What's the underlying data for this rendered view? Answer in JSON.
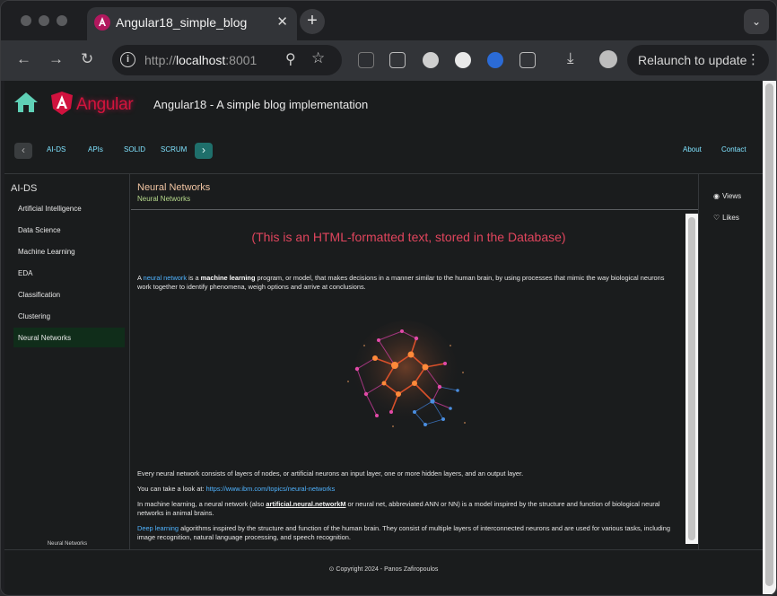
{
  "browser": {
    "tab_title": "Angular18_simple_blog",
    "tab_close": "✕",
    "new_tab": "+",
    "tab_menu": "⌄",
    "url_scheme": "http://",
    "url_host": "localhost",
    "url_port": ":8001",
    "relaunch_label": "Relaunch to update",
    "relaunch_menu": "⋮"
  },
  "header": {
    "brand": "Angular",
    "title": "Angular18 - A simple blog implementation"
  },
  "subnav": {
    "left_arrow": "‹",
    "right_arrow": "›",
    "items": [
      "AI-DS",
      "APIs",
      "SOLID",
      "SCRUM"
    ],
    "right_items": [
      "About",
      "Contact"
    ]
  },
  "sidebar": {
    "heading": "AI-DS",
    "items": [
      "Artificial Intelligence",
      "Data Science",
      "Machine Learning",
      "EDA",
      "Classification",
      "Clustering",
      "Neural Networks"
    ],
    "active_index": 6,
    "footer": "Neural Networks"
  },
  "post": {
    "title": "Neural Networks",
    "subtitle": "Neural Networks",
    "html_note": "(This is an HTML-formatted text, stored in the Database)",
    "p1_pre": "A ",
    "p1_link": "neural network",
    "p1_mid1": " is a ",
    "p1_bold": "machine learning",
    "p1_rest": " program, or model, that makes decisions in a manner similar to the human brain, by using processes that mimic the way biological neurons work together to identify phenomena, weigh options and arrive at conclusions.",
    "p2": "Every neural network consists of layers of nodes, or artificial neurons an input layer, one or more hidden layers, and an output layer.",
    "p3_pre": "You can take a look at: ",
    "p3_link": "https://www.ibm.com/topics/neural-networks",
    "p4_pre": "In machine learning, a neural network (also ",
    "p4_u": "artificial.neural.networkM",
    "p4_rest": " or neural net, abbreviated ANN or NN) is a model inspired by the structure and function of biological neural networks in animal brains.",
    "p5_link": "Deep learning",
    "p5_rest": " algorithms inspired by the structure and function of the human brain. They consist of multiple layers of interconnected neurons and are used for various tasks, including image recognition, natural language processing, and speech recognition."
  },
  "rail": {
    "views": "Views",
    "likes": "Likes"
  },
  "footer": {
    "text": "Copyright 2024 - Panos Zafiropoulos"
  },
  "colors": {
    "accent_red": "#e0455d",
    "link_blue": "#4fb3ff",
    "nav_cyan": "#7fe3ff",
    "title_peach": "#f0c4a2",
    "subtitle_green": "#b7d98c",
    "active_bg": "#102d1a"
  }
}
